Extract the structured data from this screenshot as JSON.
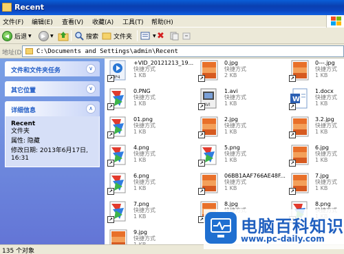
{
  "window": {
    "title": "Recent"
  },
  "menu": [
    "文件(F)",
    "编辑(E)",
    "查看(V)",
    "收藏(A)",
    "工具(T)",
    "帮助(H)"
  ],
  "toolbar": {
    "back": "后退",
    "search": "搜索",
    "folders": "文件夹"
  },
  "address": {
    "label": "地址(D)",
    "path": "C:\\Documents and Settings\\admin\\Recent"
  },
  "left_panel": {
    "tasks_title": "文件和文件夹任务",
    "other_title": "其它位置",
    "details_title": "详细信息",
    "details": {
      "name": "Recent",
      "type": "文件夹",
      "attr": "属性: 隐藏",
      "modified_label": "修改日期: 2013年6月17日,",
      "modified_time": "16:31"
    }
  },
  "files": [
    {
      "name": "+VID_20121213_19...",
      "type": "快捷方式",
      "size": "1 KB",
      "icon": "mp4-icon"
    },
    {
      "name": "0.jpg",
      "type": "快捷方式",
      "size": "2 KB",
      "icon": "jpg-icon"
    },
    {
      "name": "0---.jpg",
      "type": "快捷方式",
      "size": "1 KB",
      "icon": "jpg-icon"
    },
    {
      "name": "0.PNG",
      "type": "快捷方式",
      "size": "1 KB",
      "icon": "png-icon"
    },
    {
      "name": "1.avi",
      "type": "快捷方式",
      "size": "1 KB",
      "icon": "avi-icon"
    },
    {
      "name": "1.docx",
      "type": "快捷方式",
      "size": "1 KB",
      "icon": "docx-icon"
    },
    {
      "name": "01.png",
      "type": "快捷方式",
      "size": "1 KB",
      "icon": "png-icon"
    },
    {
      "name": "2.jpg",
      "type": "快捷方式",
      "size": "1 KB",
      "icon": "jpg-icon"
    },
    {
      "name": "3.2.jpg",
      "type": "快捷方式",
      "size": "1 KB",
      "icon": "jpg-icon"
    },
    {
      "name": "4.png",
      "type": "快捷方式",
      "size": "1 KB",
      "icon": "png-icon"
    },
    {
      "name": "5.png",
      "type": "快捷方式",
      "size": "1 KB",
      "icon": "png-icon"
    },
    {
      "name": "6.jpg",
      "type": "快捷方式",
      "size": "1 KB",
      "icon": "jpg-icon"
    },
    {
      "name": "6.png",
      "type": "快捷方式",
      "size": "1 KB",
      "icon": "png-icon"
    },
    {
      "name": "06BB1AAF766AE48F...",
      "type": "快捷方式",
      "size": "1 KB",
      "icon": "jpg-icon"
    },
    {
      "name": "7.jpg",
      "type": "快捷方式",
      "size": "1 KB",
      "icon": "jpg-icon"
    },
    {
      "name": "7.png",
      "type": "快捷方式",
      "size": "1 KB",
      "icon": "png-icon"
    },
    {
      "name": "8.jpg",
      "type": "快捷方式",
      "size": "1 KB",
      "icon": "jpg-icon"
    },
    {
      "name": "8.png",
      "type": "快捷方式",
      "size": "1 KB",
      "icon": "png-icon"
    },
    {
      "name": "9.jpg",
      "type": "快捷方式",
      "size": "1 KB",
      "icon": "jpg-icon"
    }
  ],
  "status": {
    "text": "135 个对象"
  },
  "watermark": {
    "title": "电脑百科知识",
    "url": "www.pc-daily.com"
  },
  "colors": {
    "titlebar": "#0a4fc8",
    "left_pane": "#7aa1e6",
    "panel_title": "#215dc6",
    "watermark": "#1f5fbf"
  }
}
